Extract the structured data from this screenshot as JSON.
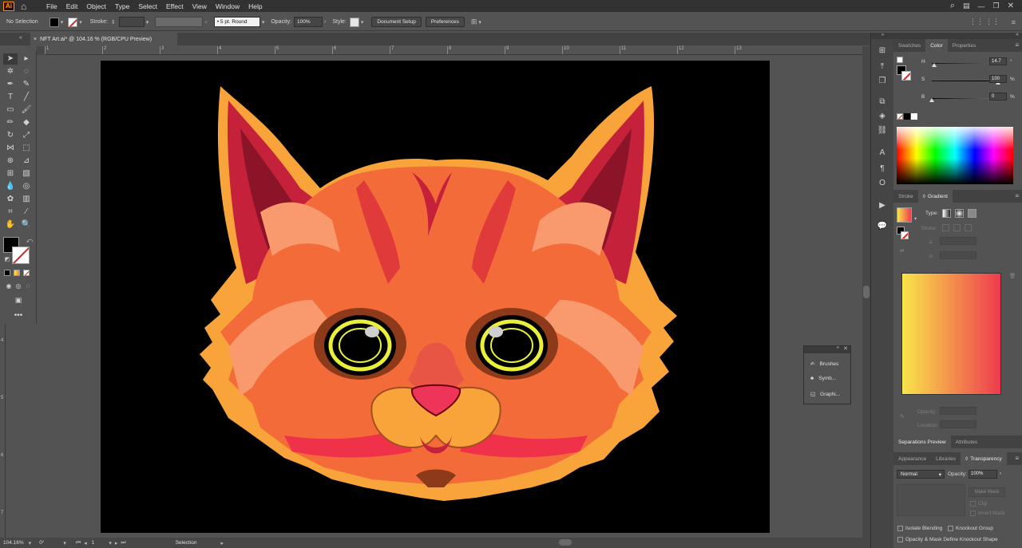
{
  "app": {
    "logo": "Ai",
    "menus": [
      "File",
      "Edit",
      "Object",
      "Type",
      "Select",
      "Effect",
      "View",
      "Window",
      "Help"
    ]
  },
  "control_bar": {
    "selection_state": "No Selection",
    "stroke_label": "Stroke:",
    "brush_value": "5 pt. Round",
    "opacity_label": "Opacity:",
    "opacity_value": "100%",
    "style_label": "Style:",
    "document_setup_button": "Document Setup",
    "preferences_button": "Preferences"
  },
  "document_tab": {
    "title": "NFT Art.ai* @ 104.16 % (RGB/CPU Preview)",
    "close_glyph": "×"
  },
  "ruler": {
    "top_labels": [
      "1",
      "2",
      "3",
      "4",
      "5",
      "6",
      "7",
      "8",
      "9",
      "10",
      "11",
      "12",
      "13"
    ],
    "left_labels": [
      "4",
      "5",
      "6",
      "7"
    ]
  },
  "status_bar": {
    "zoom": "104.16%",
    "rotation": "0°",
    "artboard_number": "1",
    "tool_name": "Selection"
  },
  "color_panel": {
    "tabs": [
      "Swatches",
      "Color",
      "Properties"
    ],
    "active_tab": "Color",
    "h_label": "H",
    "s_label": "S",
    "b_label": "B",
    "h_value": "14.7",
    "s_value": "100",
    "b_value": "0",
    "h_fraction": 0.04,
    "s_fraction": 1.0,
    "b_fraction": 0.0,
    "percent": "%"
  },
  "gradient_panel": {
    "tabs": [
      "Stroke",
      "Gradient"
    ],
    "active_tab": "Gradient",
    "type_label": "Type:",
    "stroke_label": "Stroke:",
    "opacity_label": "Opacity:",
    "location_label": "Location:",
    "gradient_start": "#f9e54a",
    "gradient_end": "#ee3b4f"
  },
  "appearance_tabs_top": {
    "tabs": [
      "Separations Preview",
      "Attributes"
    ],
    "active_tab": "Separations Preview"
  },
  "transparency_panel": {
    "tabs": [
      "Appearance",
      "Libraries",
      "Transparency"
    ],
    "active_tab": "Transparency",
    "blend_mode": "Normal",
    "opacity_label": "Opacity:",
    "opacity_value": "100%",
    "make_mask_button": "Make Mask",
    "clip_label": "Clip",
    "invert_mask_label": "Invert Mask",
    "isolate_blending": "Isolate Blending",
    "knockout_group": "Knockout Group",
    "opacity_mask_define": "Opacity & Mask Define Knockout Shape"
  },
  "floating_panel": {
    "items": [
      "Brushes",
      "Symb...",
      "Graphi..."
    ]
  },
  "colors": {
    "artboard_bg": "#000000",
    "fur_orange": "#f46b3a",
    "fur_light": "#f99a6e",
    "fur_red": "#c5213a",
    "fur_dark": "#8c1428",
    "fur_yellow": "#f9a43a",
    "eye_yellow": "#e8f03a",
    "nose_pink": "#ee3458"
  }
}
